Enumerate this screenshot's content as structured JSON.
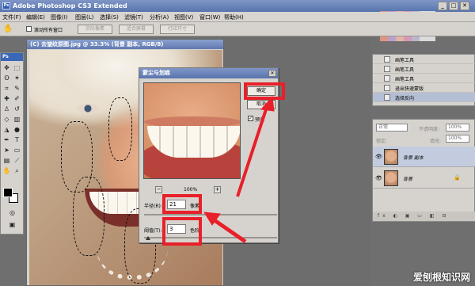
{
  "window": {
    "title": "Adobe Photoshop CS3 Extended"
  },
  "menu": [
    "文件(F)",
    "编辑(E)",
    "图像(I)",
    "图层(L)",
    "选择(S)",
    "滤镜(T)",
    "分析(A)",
    "视图(V)",
    "窗口(W)",
    "帮助(H)"
  ],
  "options": {
    "scroll_all_windows": "滚动所有窗口",
    "actual_pixels": "实际像素",
    "fit_screen": "适合屏幕",
    "print_size": "打印尺寸"
  },
  "toolbox": {
    "header": "Ps"
  },
  "document": {
    "title": "(C) 去皱纹原图.jpg @ 33.3% (背景 副本, RGB/8)"
  },
  "dialog": {
    "title": "蒙尘与划痕",
    "ok": "确定",
    "cancel": "取消",
    "preview_label": "预览",
    "zoom": "100%",
    "zoom_out": "−",
    "zoom_in": "+",
    "radius_label": "半径(R):",
    "radius_value": "21",
    "radius_unit": "像素",
    "threshold_label": "阈值(T):",
    "threshold_value": "3",
    "threshold_unit": "色阶"
  },
  "history": {
    "items": [
      {
        "label": "画笔工具",
        "selected": false
      },
      {
        "label": "画笔工具",
        "selected": false
      },
      {
        "label": "画笔工具",
        "selected": false
      },
      {
        "label": "退出快速蒙版",
        "selected": false
      },
      {
        "label": "选择反向",
        "selected": true
      }
    ]
  },
  "layers": {
    "blend_mode": "正常",
    "opacity_label": "不透明度:",
    "opacity_value": "100%",
    "lock_label": "锁定:",
    "fill_label": "填充:",
    "fill_value": "100%",
    "items": [
      {
        "name": "背景 副本",
        "selected": true
      },
      {
        "name": "背景",
        "selected": false
      }
    ],
    "footer_icons": "fx ◐ ▣ ▭ ◧ ⊟"
  },
  "watermark": "爱刨根知识网"
}
